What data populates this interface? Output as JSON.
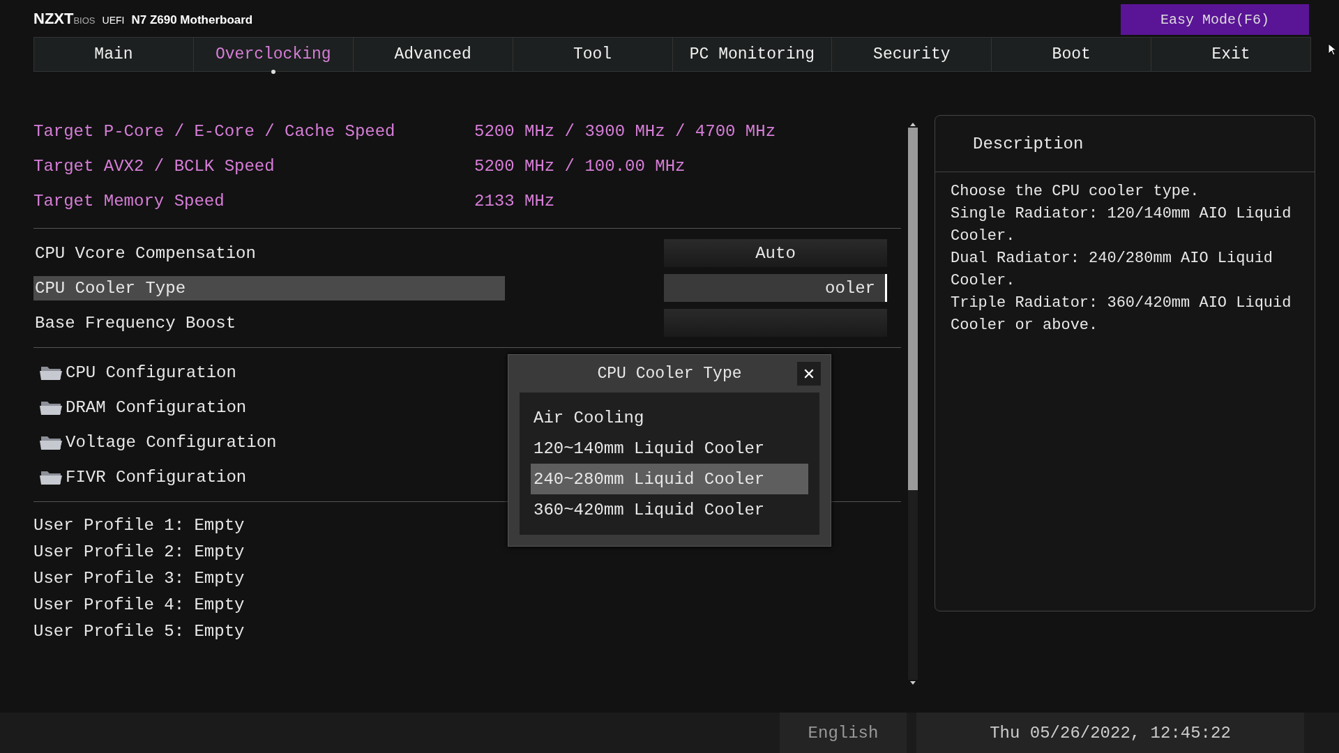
{
  "header": {
    "brand": "NZXT",
    "sub": "BIOS",
    "uefi": "UEFI",
    "model": "N7 Z690 Motherboard",
    "mode_button": "Easy Mode(F6)"
  },
  "tabs": [
    {
      "label": "Main",
      "selected": false
    },
    {
      "label": "Overclocking",
      "selected": true
    },
    {
      "label": "Advanced",
      "selected": false
    },
    {
      "label": "Tool",
      "selected": false
    },
    {
      "label": "PC Monitoring",
      "selected": false
    },
    {
      "label": "Security",
      "selected": false
    },
    {
      "label": "Boot",
      "selected": false
    },
    {
      "label": "Exit",
      "selected": false
    }
  ],
  "targets": [
    {
      "label": "Target P-Core / E-Core / Cache Speed",
      "value": "5200 MHz / 3900 MHz / 4700 MHz"
    },
    {
      "label": "Target AVX2 / BCLK Speed",
      "value": "5200 MHz / 100.00 MHz"
    },
    {
      "label": "Target Memory Speed",
      "value": "2133 MHz"
    }
  ],
  "settings": [
    {
      "label": "CPU Vcore Compensation",
      "value": "Auto",
      "selected": false
    },
    {
      "label": "CPU Cooler Type",
      "value": "ooler",
      "selected": true
    },
    {
      "label": "Base Frequency Boost",
      "selected": false
    }
  ],
  "submenus": [
    {
      "label": "CPU Configuration"
    },
    {
      "label": "DRAM Configuration"
    },
    {
      "label": "Voltage Configuration"
    },
    {
      "label": "FIVR Configuration"
    }
  ],
  "profiles": [
    "User Profile 1: Empty",
    "User Profile 2: Empty",
    "User Profile 3: Empty",
    "User Profile 4: Empty",
    "User Profile 5: Empty"
  ],
  "popup": {
    "title": "CPU Cooler Type",
    "close": "✕",
    "options": [
      {
        "label": "Air Cooling",
        "selected": false
      },
      {
        "label": "120~140mm Liquid Cooler",
        "selected": false
      },
      {
        "label": "240~280mm Liquid Cooler",
        "selected": true
      },
      {
        "label": "360~420mm Liquid Cooler",
        "selected": false
      }
    ]
  },
  "description": {
    "title": "Description",
    "lines": [
      "Choose the CPU cooler type.",
      "Single Radiator: 120/140mm AIO Liquid Cooler.",
      "Dual Radiator: 240/280mm AIO Liquid Cooler.",
      "Triple Radiator: 360/420mm AIO Liquid Cooler or above."
    ]
  },
  "status_bar": {
    "language": "English",
    "datetime": "Thu 05/26/2022, 12:45:22"
  }
}
